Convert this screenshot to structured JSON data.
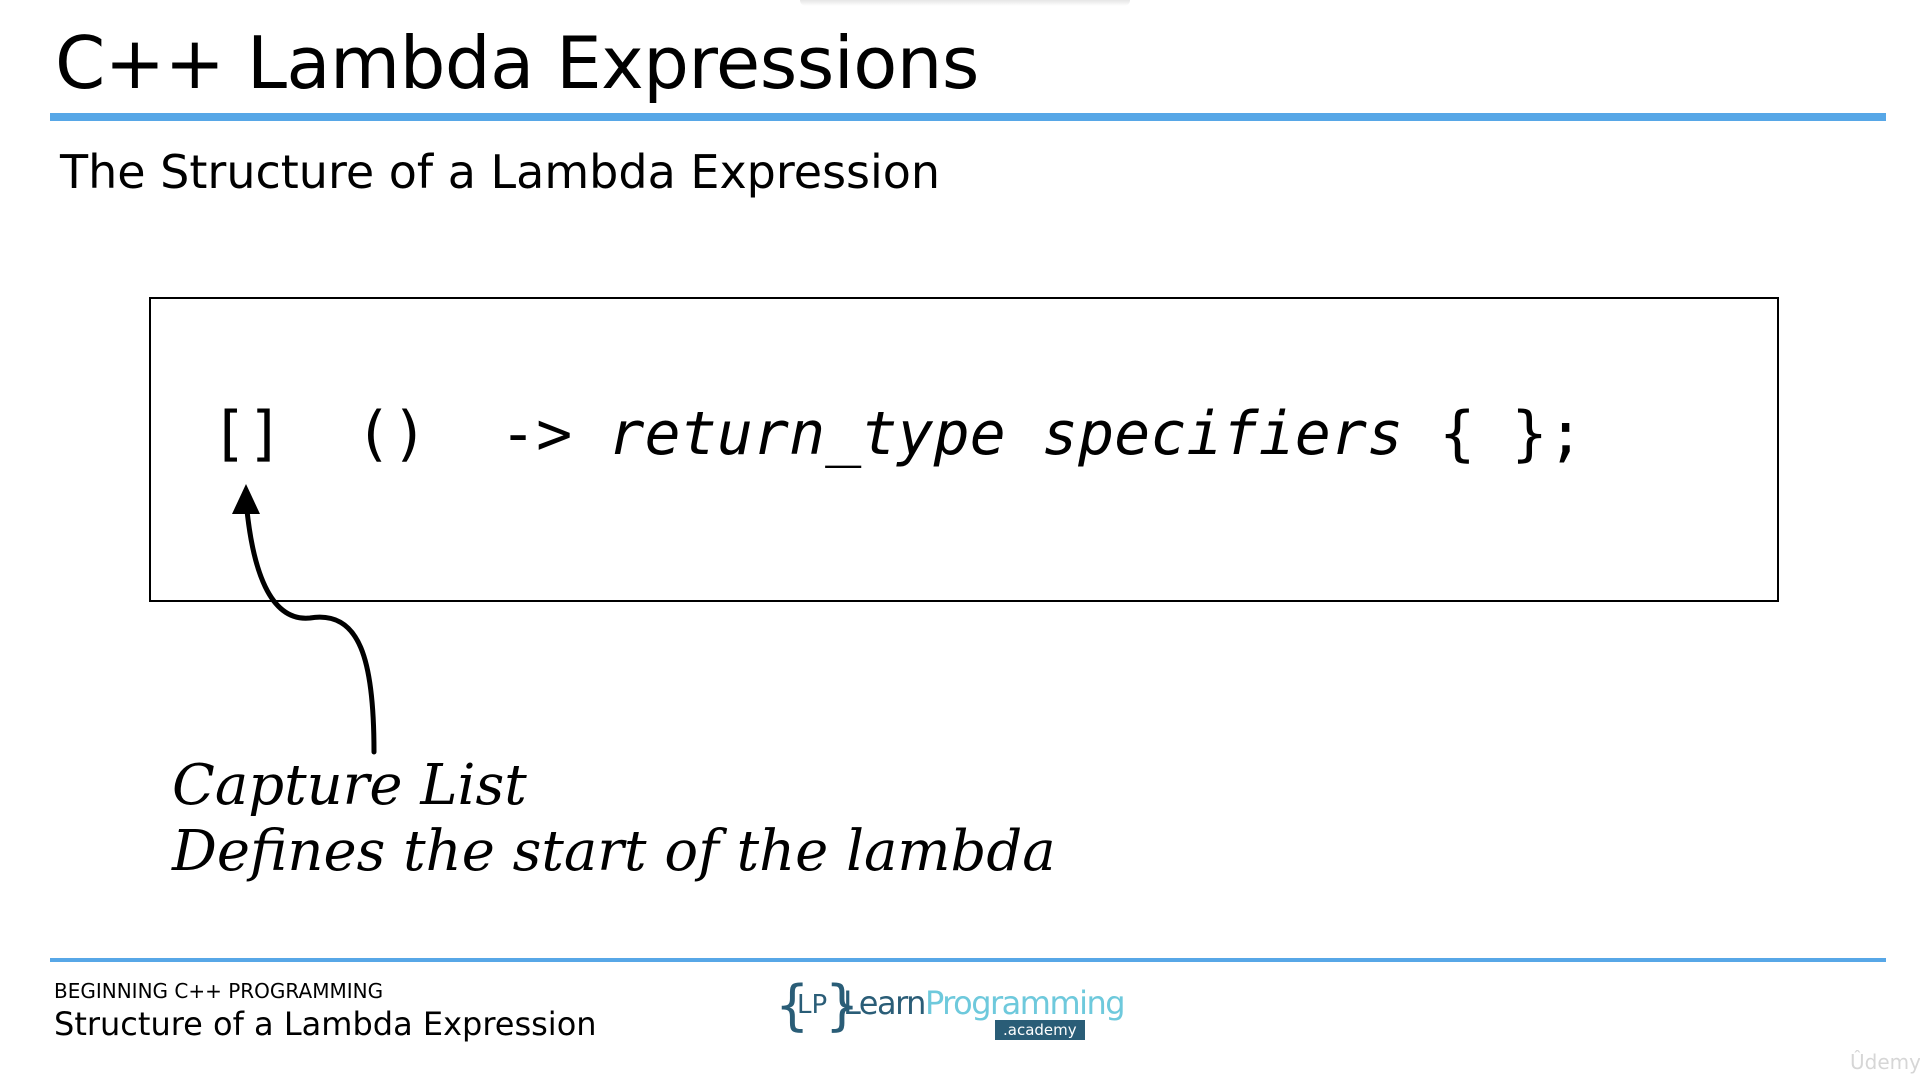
{
  "slide": {
    "title": "C++ Lambda Expressions",
    "subtitle": "The Structure of a Lambda Expression"
  },
  "code": {
    "capture": "[]",
    "params": "()",
    "arrow": "->",
    "return_type": "return_type",
    "specifiers": "specifiers",
    "body": "{ }",
    "terminator": ";"
  },
  "annotation": {
    "line1": "Capture List",
    "line2": "Defines the start of the lambda"
  },
  "footer": {
    "course": "BEGINNING C++ PROGRAMMING",
    "lecture": "Structure of a Lambda Expression",
    "logo": {
      "brace_open": "{",
      "initials": "LP",
      "brace_close": "}",
      "learn": "Learn",
      "programming": "Programming",
      "academy": ".academy"
    }
  },
  "watermark": "Ûdemy",
  "colors": {
    "accent_rule": "#57a7e7",
    "logo_dark": "#2a5d77",
    "logo_light": "#6ec9dc"
  }
}
